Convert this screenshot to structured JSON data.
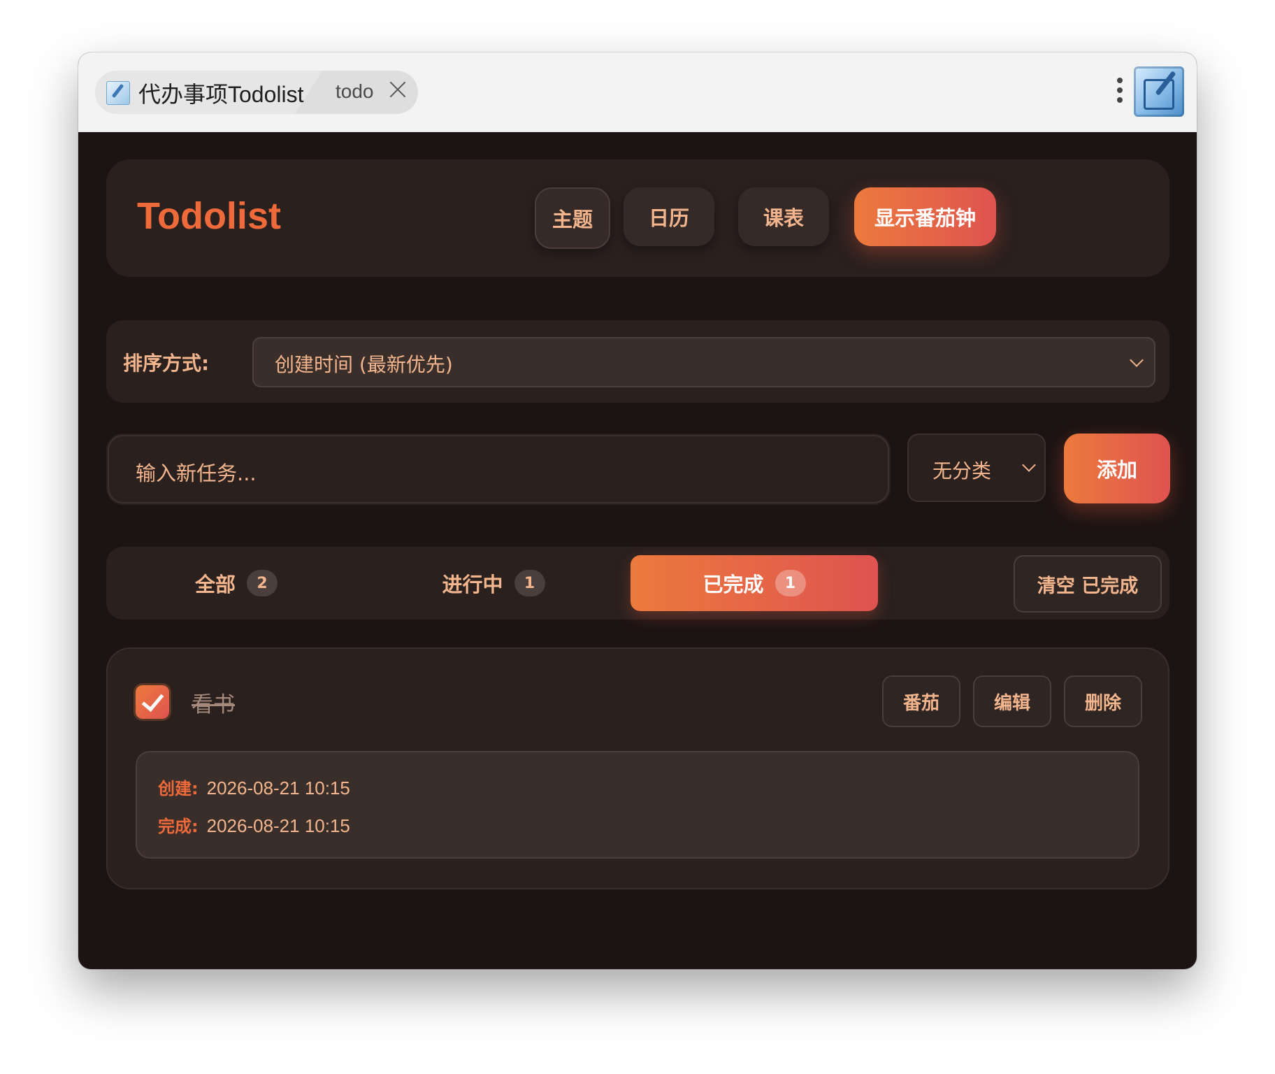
{
  "window": {
    "tab_title": "代办事项Todolist",
    "tab_sub": "todo",
    "app_icon": "notepad-pen-icon"
  },
  "header": {
    "brand": "Todolist",
    "buttons": {
      "theme": "主题",
      "calendar": "日历",
      "schedule": "课表",
      "pomodoro": "显示番茄钟"
    }
  },
  "sort": {
    "label": "排序方式:",
    "selected": "创建时间 (最新优先)"
  },
  "new_task": {
    "placeholder": "输入新任务...",
    "category": "无分类",
    "add_label": "添加"
  },
  "filters": {
    "tabs": [
      {
        "label": "全部",
        "count": "2"
      },
      {
        "label": "进行中",
        "count": "1"
      },
      {
        "label": "已完成",
        "count": "1"
      }
    ],
    "active": "已完成",
    "clear_label": "清空 已完成"
  },
  "todos": [
    {
      "text": "看书",
      "done": true,
      "actions": {
        "pomodoro": "番茄",
        "edit": "编辑",
        "delete": "删除"
      },
      "created_label": "创建:",
      "created": "2026-08-21 10:15",
      "completed_label": "完成:",
      "completed": "2026-08-21 10:15"
    }
  ],
  "colors": {
    "accent": "#ec7a3d",
    "accent_end": "#df5350",
    "text_warm": "#f3b58d",
    "background": "#1c1413",
    "card": "#2a201e"
  }
}
